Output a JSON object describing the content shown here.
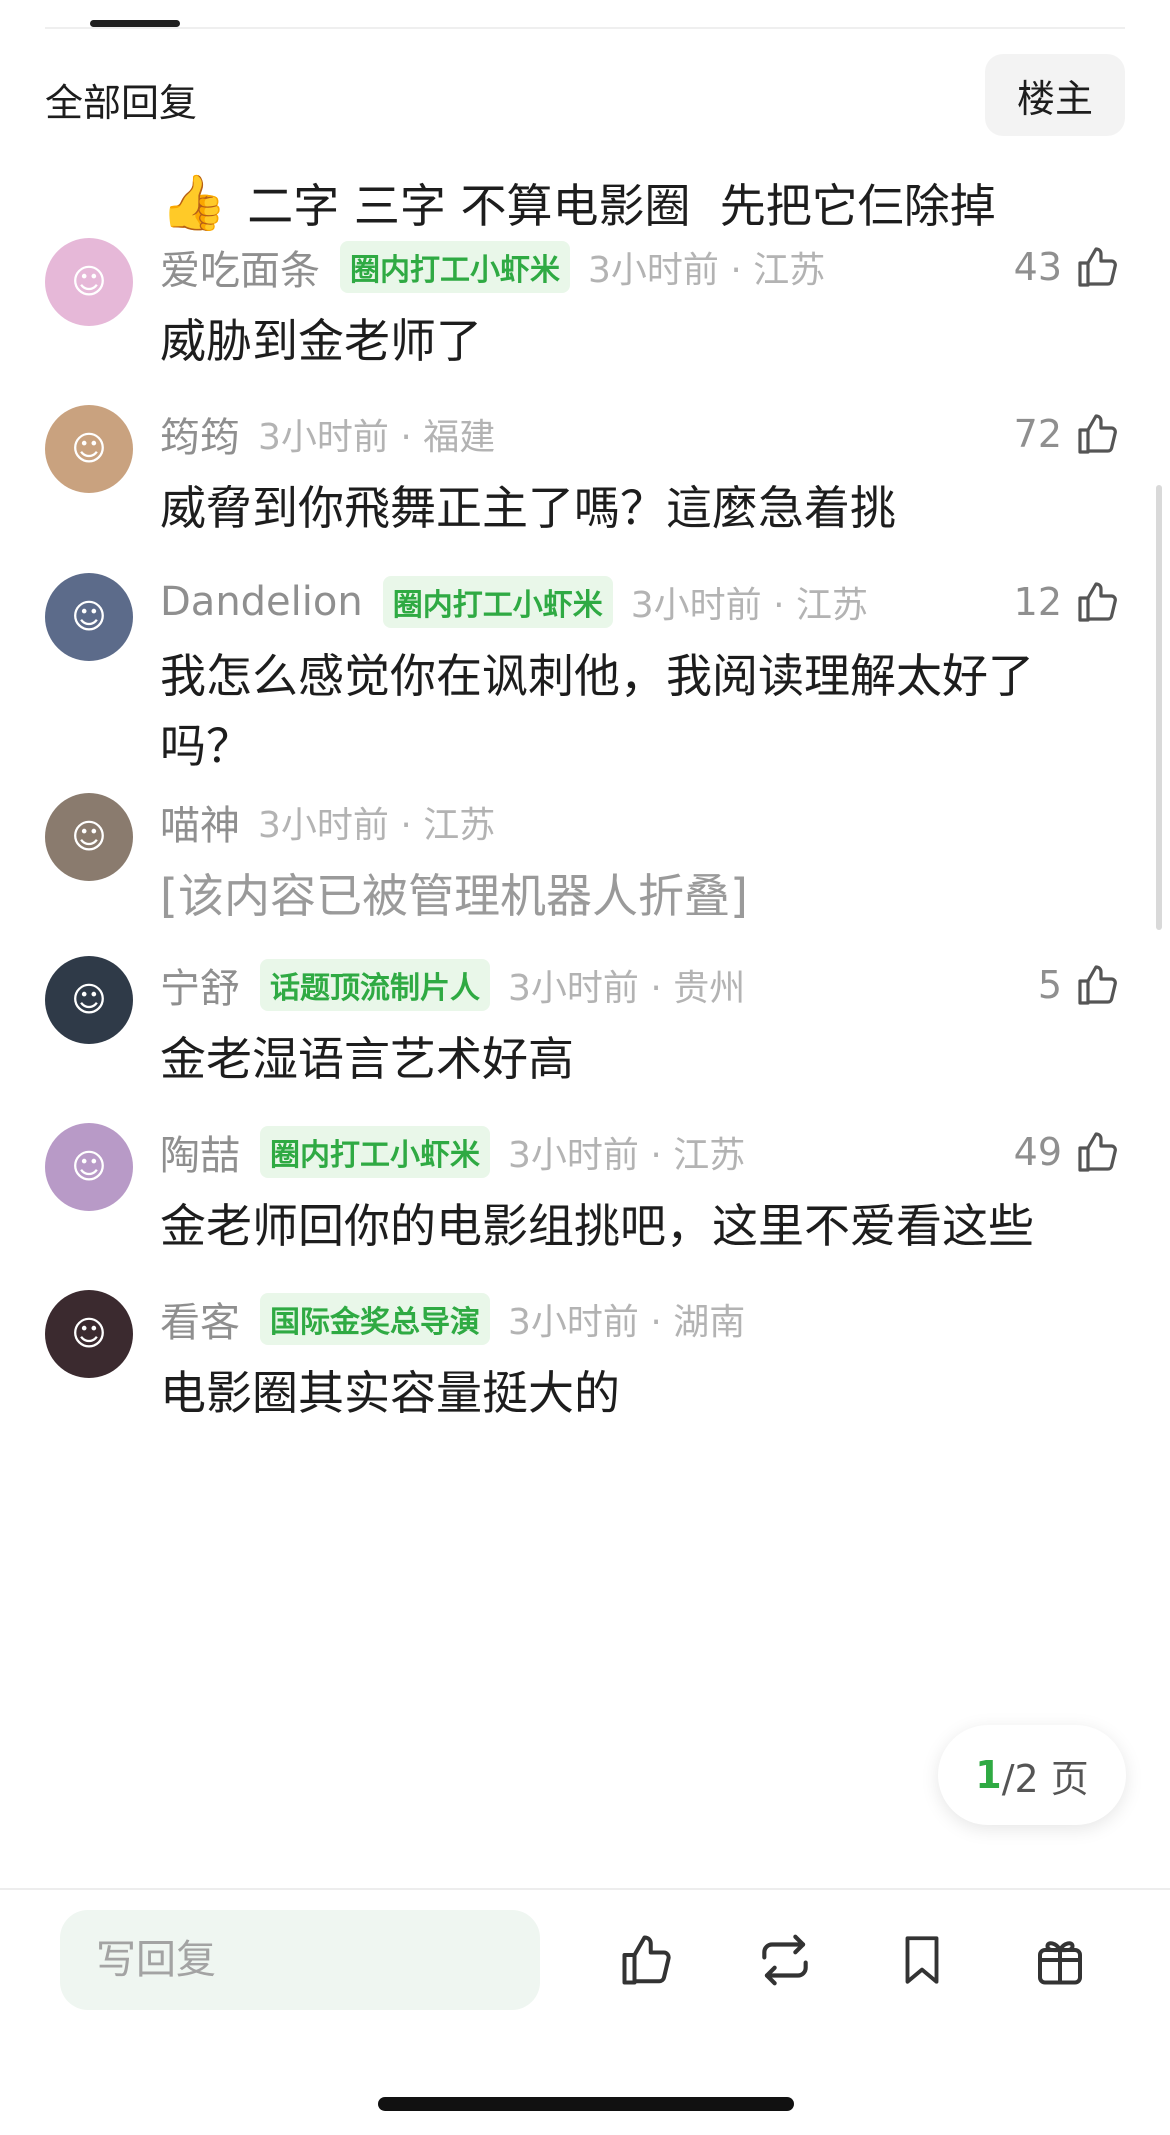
{
  "header": {
    "title": "全部回复",
    "op_button": "楼主"
  },
  "op_post": {
    "emoji": "👍",
    "text": "二字 三字 不算电影圈  先把它仨除掉"
  },
  "comments": [
    {
      "user": "爱吃面条",
      "badge": "圈内打工小虾米",
      "time": "3小时前 · 江苏",
      "likes": "43",
      "text": "威胁到金老师了",
      "avatar_color": "#e6b8d8"
    },
    {
      "user": "筠筠",
      "badge": "",
      "time": "3小时前 · 福建",
      "likes": "72",
      "text": "威脅到你飛舞正主了嗎？這麼急着挑",
      "avatar_color": "#c9a27f"
    },
    {
      "user": "Dandelion",
      "badge": "圈内打工小虾米",
      "time": "3小时前 · 江苏",
      "likes": "12",
      "text": "我怎么感觉你在讽刺他，我阅读理解太好了吗？",
      "avatar_color": "#5c6b8a"
    },
    {
      "user": "喵神",
      "badge": "",
      "time": "3小时前 · 江苏",
      "likes": "",
      "text": "[该内容已被管理机器人折叠]",
      "avatar_color": "#8a7b6e",
      "folded": true
    },
    {
      "user": "宁舒",
      "badge": "话题顶流制片人",
      "time": "3小时前 · 贵州",
      "likes": "5",
      "text": "金老湿语言艺术好高",
      "avatar_color": "#2f3a48"
    },
    {
      "user": "陶喆",
      "badge": "圈内打工小虾米",
      "time": "3小时前 · 江苏",
      "likes": "49",
      "text": "金老师回你的电影组挑吧，这里不爱看这些",
      "avatar_color": "#b89ac7"
    },
    {
      "user": "看客",
      "badge": "国际金奖总导演",
      "time": "3小时前 · 湖南",
      "likes": "",
      "text": "电影圈其实容量挺大的",
      "avatar_color": "#3b2a2f"
    }
  ],
  "pager": {
    "current": "1",
    "rest": "/2 页"
  },
  "bottom_bar": {
    "reply_placeholder": "写回复"
  },
  "icons": {
    "like": "thumb-up-icon",
    "repost": "repost-icon",
    "bookmark": "bookmark-icon",
    "gift": "gift-icon"
  },
  "colors": {
    "accent_green": "#2faa43",
    "badge_bg": "#e9f7e9",
    "muted_text": "#8f8f8f"
  }
}
